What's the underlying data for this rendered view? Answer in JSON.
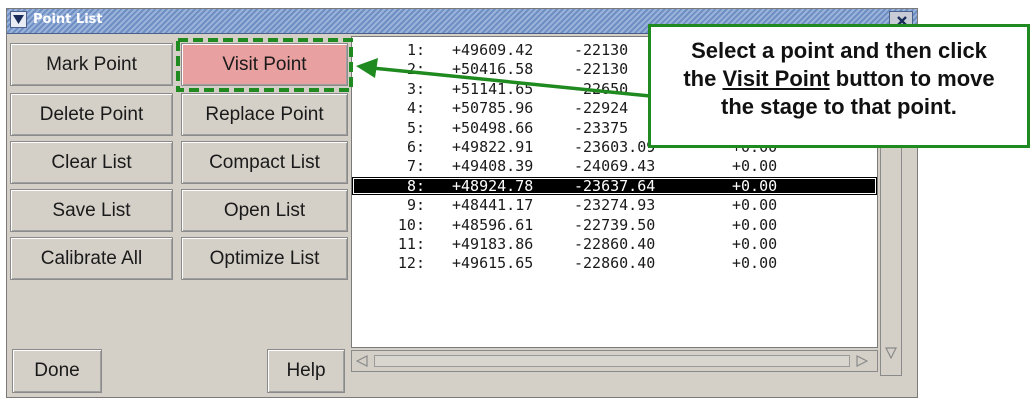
{
  "window": {
    "title": "Point List"
  },
  "buttons": {
    "mark_point": "Mark Point",
    "visit_point": "Visit Point",
    "delete_point": "Delete Point",
    "replace_point": "Replace Point",
    "clear_list": "Clear List",
    "compact_list": "Compact List",
    "save_list": "Save List",
    "open_list": "Open List",
    "calibrate_all": "Calibrate All",
    "optimize_list": "Optimize List",
    "done": "Done",
    "help": "Help"
  },
  "points": [
    {
      "index": "1:",
      "x": "+49609.42",
      "y": "-22130",
      "z": ""
    },
    {
      "index": "2:",
      "x": "+50416.58",
      "y": "-22130",
      "z": ""
    },
    {
      "index": "3:",
      "x": "+51141.65",
      "y": "-22650",
      "z": ""
    },
    {
      "index": "4:",
      "x": "+50785.96",
      "y": "-22924",
      "z": ""
    },
    {
      "index": "5:",
      "x": "+50498.66",
      "y": "-23375",
      "z": ""
    },
    {
      "index": "6:",
      "x": "+49822.91",
      "y": "-23603.09",
      "z": "+0.00"
    },
    {
      "index": "7:",
      "x": "+49408.39",
      "y": "-24069.43",
      "z": "+0.00"
    },
    {
      "index": "8:",
      "x": "+48924.78",
      "y": "-23637.64",
      "z": "+0.00"
    },
    {
      "index": "9:",
      "x": "+48441.17",
      "y": "-23274.93",
      "z": "+0.00"
    },
    {
      "index": "10:",
      "x": "+48596.61",
      "y": "-22739.50",
      "z": "+0.00"
    },
    {
      "index": "11:",
      "x": "+49183.86",
      "y": "-22860.40",
      "z": "+0.00"
    },
    {
      "index": "12:",
      "x": "+49615.65",
      "y": "-22860.40",
      "z": "+0.00"
    }
  ],
  "selected_row": "8:",
  "callout": {
    "line1": "Select a point and then click",
    "line2_prefix": "the ",
    "line2_link": "Visit Point",
    "line2_suffix": " button to move",
    "line3": "the stage to that point."
  },
  "colors": {
    "callout_border": "#1f8a1f",
    "arrow": "#1f8a1f",
    "highlight_fill": "#e9a0a0",
    "selection": "#000000"
  },
  "icons": {
    "title_menu": "chevron-down-icon",
    "close": "close-icon",
    "scroll_left": "triangle-left-icon",
    "scroll_right": "triangle-right-icon",
    "scroll_down": "triangle-down-icon"
  }
}
